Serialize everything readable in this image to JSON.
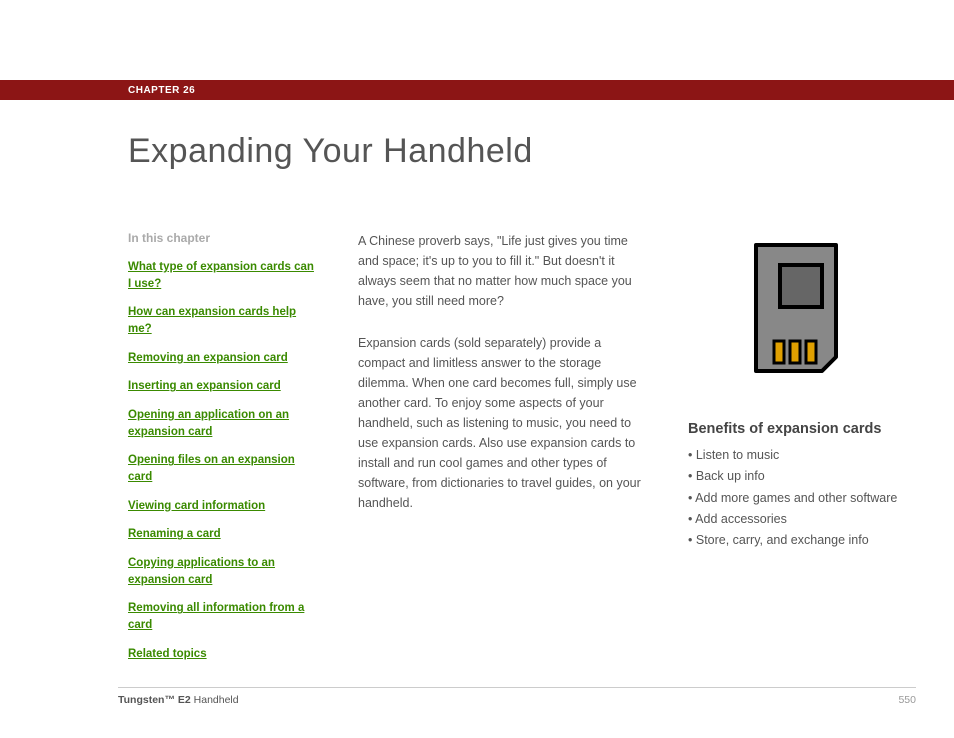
{
  "chapter_label": "CHAPTER 26",
  "page_title": "Expanding Your Handheld",
  "sidebar": {
    "heading": "In this chapter",
    "links": [
      "What type of expansion cards can I use?",
      "How can expansion cards help me?",
      "Removing an expansion card",
      "Inserting an expansion card",
      "Opening an application on an expansion card",
      "Opening files on an expansion card",
      "Viewing card information",
      "Renaming a card",
      "Copying applications to an expansion card",
      "Removing all information from a card",
      "Related topics"
    ]
  },
  "paragraphs": [
    "A Chinese proverb says, \"Life just gives you time and space; it's up to you to fill it.\" But doesn't it always seem that no matter how much space you have, you still need more?",
    "Expansion cards (sold separately) provide a compact and limitless answer to the storage dilemma. When one card becomes full, simply use another card. To enjoy some aspects of your handheld, such as listening to music, you need to use expansion cards. Also use expansion cards to install and run cool games and other types of software, from dictionaries to travel guides, on your handheld."
  ],
  "benefits": {
    "heading": "Benefits of expansion cards",
    "items": [
      "Listen to music",
      "Back up info",
      "Add more games and other software",
      "Add accessories",
      "Store, carry, and exchange info"
    ]
  },
  "footer": {
    "product_bold": "Tungsten™ E2",
    "product_rest": " Handheld",
    "page": "550"
  }
}
